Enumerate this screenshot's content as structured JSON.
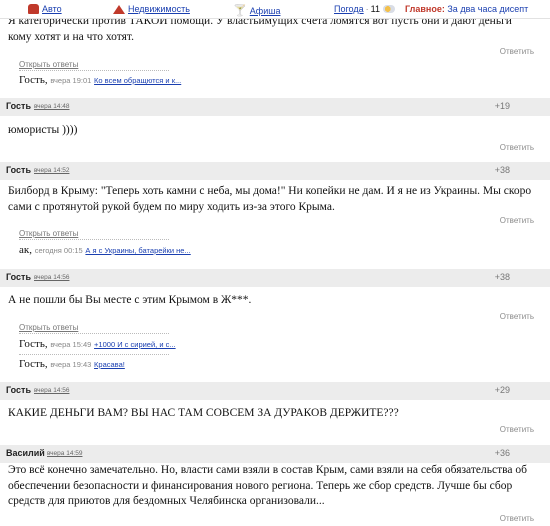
{
  "topbar": {
    "auto": "Авто",
    "realty": "Недвижимость",
    "afisha": "Афиша",
    "weather_label": "Погода",
    "weather_temp": "11",
    "main_label": "Главное:",
    "main_link": "За два часа дисепт"
  },
  "reply_label": "Ответить",
  "open_replies_label": "Открыть ответы",
  "first_comment": {
    "text": "Я категорически против ТАКОЙ помощи. У властьимущих счета ломятся вот пусть они и дают деньги кому хотят и на что хотят.",
    "subreplies": [
      {
        "author": "Гость,",
        "when": "вчера 19:01",
        "snippet": "Ко всем обращются и к..."
      }
    ]
  },
  "comments": [
    {
      "author": "Гость",
      "time": "вчера 14:48",
      "rating": "+19",
      "text": "юмористы ))))"
    },
    {
      "author": "Гость",
      "time": "вчера 14:52",
      "rating": "+38",
      "text": "Билборд в Крыму: \"Теперь хоть камни с неба, мы дома!\" Ни копейки не дам. И я не из Украины. Мы скоро сами с протянутой рукой будем по миру ходить из-за этого Крыма.",
      "subreplies": [
        {
          "author": "ак,",
          "when": "сегодня 00:15",
          "snippet": "А я с Украины, батарейки не..."
        }
      ]
    },
    {
      "author": "Гость",
      "time": "вчера 14:56",
      "rating": "+38",
      "text": "А не пошли бы Вы месте с этим Крымом в Ж***.",
      "subreplies": [
        {
          "author": "Гость,",
          "when": "вчера 15:49",
          "snippet": "+1000 И с сирией, и с..."
        },
        {
          "author": "Гость,",
          "when": "вчера 19:43",
          "snippet": "Красава!"
        }
      ]
    },
    {
      "author": "Гость",
      "time": "вчера 14:56",
      "rating": "+29",
      "text": "КАКИЕ ДЕНЬГИ ВАМ? ВЫ НАС ТАМ СОВСЕМ ЗА ДУРАКОВ ДЕРЖИТЕ???"
    },
    {
      "author": "Василий",
      "time": "вчера 14:59",
      "rating": "+36",
      "text": "Это всё конечно замечательно. Но, власти сами взяли в состав Крым, сами взяли на себя обязательства об обеспечении безопасности и финансирования нового региона. Теперь же сбор средств. Лучше бы сбор средств для приютов для бездомных Челябинска организовали..."
    }
  ]
}
